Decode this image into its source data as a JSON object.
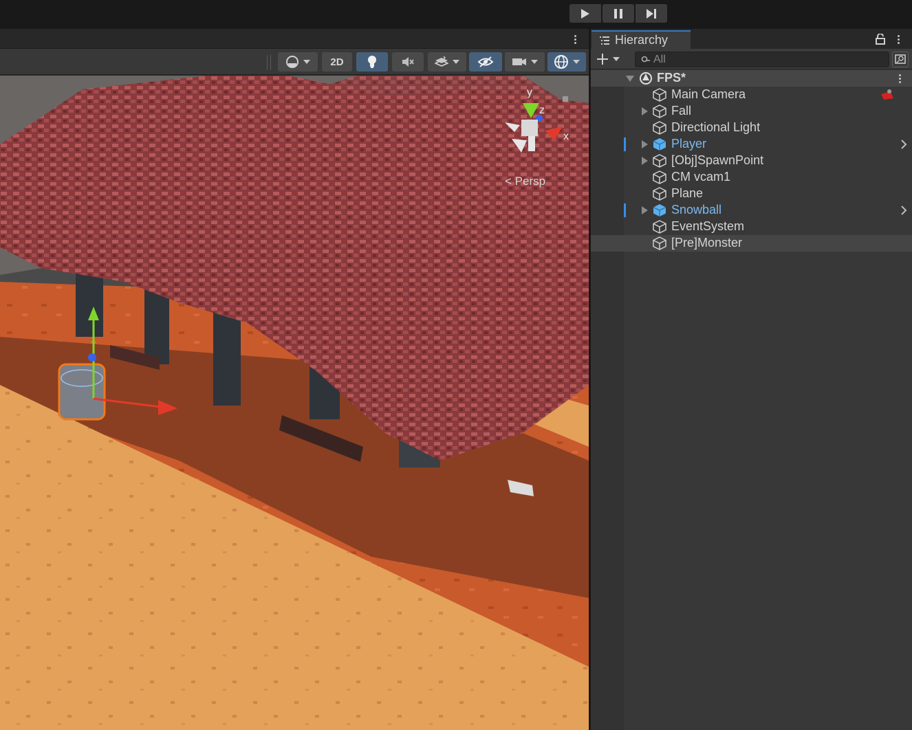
{
  "toolbar": {
    "play": "play-icon",
    "pause": "pause-icon",
    "step": "step-icon"
  },
  "scene_view": {
    "toolbar": {
      "mode_2d_label": "2D"
    },
    "gizmo": {
      "axis_x": "x",
      "axis_y": "y",
      "axis_z": "z",
      "projection_label": "Persp"
    }
  },
  "hierarchy": {
    "tab_label": "Hierarchy",
    "search_placeholder": "All",
    "scene": {
      "name": "FPS*"
    },
    "items": [
      {
        "label": "Main Camera",
        "expandable": false,
        "prefab": false
      },
      {
        "label": "Fall",
        "expandable": true,
        "prefab": false
      },
      {
        "label": "Directional Light",
        "expandable": false,
        "prefab": false
      },
      {
        "label": "Player",
        "expandable": true,
        "prefab": true
      },
      {
        "label": "[Obj]SpawnPoint",
        "expandable": true,
        "prefab": false
      },
      {
        "label": "CM vcam1",
        "expandable": false,
        "prefab": false
      },
      {
        "label": "Plane",
        "expandable": false,
        "prefab": false
      },
      {
        "label": "Snowball",
        "expandable": true,
        "prefab": true
      },
      {
        "label": "EventSystem",
        "expandable": false,
        "prefab": false
      },
      {
        "label": "[Pre]Monster",
        "expandable": false,
        "prefab": false,
        "selected": true
      }
    ]
  },
  "colors": {
    "prefab_text": "#7cb8ee",
    "selection_marker": "#3a8ee6",
    "active_button": "#46607c",
    "panel_bg": "#383838"
  }
}
